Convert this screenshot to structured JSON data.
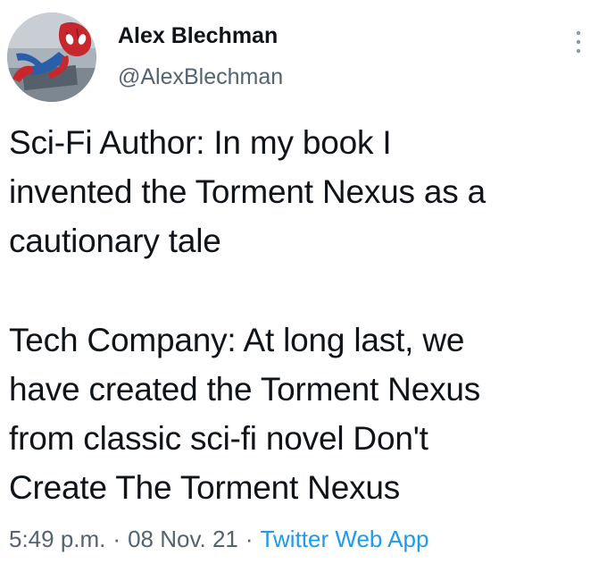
{
  "author": {
    "display_name": "Alex Blechman",
    "handle": "@AlexBlechman"
  },
  "icons": {
    "more": "more-vertical-icon",
    "avatar": "spiderman-avatar"
  },
  "tweet": {
    "paragraph_1": [
      "Sci-Fi Author: In my book I",
      "invented the Torment Nexus as a",
      "cautionary tale"
    ],
    "paragraph_2": [
      "Tech Company: At long last, we",
      "have created the Torment Nexus",
      "from classic sci-fi novel Don't",
      "Create The Torment Nexus"
    ]
  },
  "meta": {
    "time": "5:49 p.m.",
    "separator": "·",
    "date": "08 Nov. 21",
    "source": "Twitter Web App"
  },
  "colors": {
    "text_primary": "#0f1419",
    "text_secondary": "#536471",
    "link": "#1d9bf0"
  }
}
